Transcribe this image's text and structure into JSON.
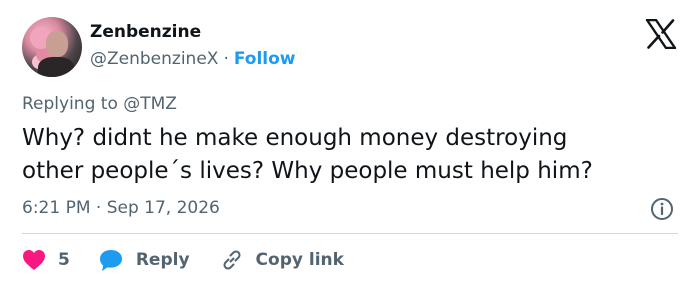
{
  "author": {
    "display_name": "Zenbenzine",
    "handle": "@ZenbenzineX",
    "separator": "·",
    "follow_label": "Follow"
  },
  "reply_context": "Replying to @TMZ",
  "tweet": {
    "text": "Why? didnt he make enough money destroying\nother people´s lives? Why people must help him?",
    "timestamp": "6:21 PM · Sep 17, 2026"
  },
  "actions": {
    "like_count": "5",
    "reply_label": "Reply",
    "copy_link_label": "Copy link"
  },
  "colors": {
    "accent": "#1d9bf0",
    "like": "#f91880",
    "text_primary": "#0f1419",
    "text_secondary": "#536471",
    "divider": "#cfd9de"
  },
  "icons": [
    "x-logo-icon",
    "info-icon",
    "heart-icon",
    "reply-bubble-icon",
    "link-icon"
  ]
}
